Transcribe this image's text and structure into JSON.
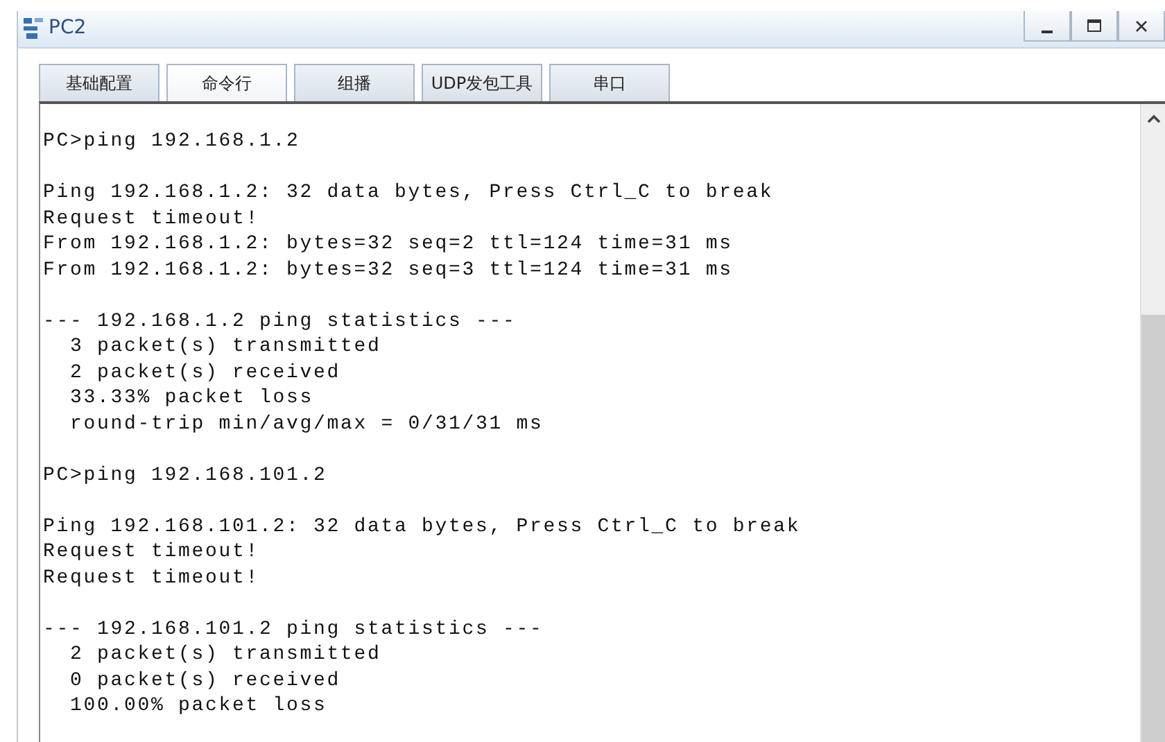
{
  "window": {
    "title": "PC2"
  },
  "tabs": [
    {
      "label": "基础配置",
      "selected": false
    },
    {
      "label": "命令行",
      "selected": true
    },
    {
      "label": "组播",
      "selected": false
    },
    {
      "label": "UDP发包工具",
      "selected": false
    },
    {
      "label": "串口",
      "selected": false
    }
  ],
  "terminal": {
    "blocks": [
      [
        "PC>ping 192.168.1.2"
      ],
      [
        "Ping 192.168.1.2: 32 data bytes, Press Ctrl_C to break",
        "Request timeout!",
        "From 192.168.1.2: bytes=32 seq=2 ttl=124 time=31 ms",
        "From 192.168.1.2: bytes=32 seq=3 ttl=124 time=31 ms"
      ],
      [
        "--- 192.168.1.2 ping statistics ---",
        "  3 packet(s) transmitted",
        "  2 packet(s) received",
        "  33.33% packet loss",
        "  round-trip min/avg/max = 0/31/31 ms"
      ],
      [
        "PC>ping 192.168.101.2"
      ],
      [
        "Ping 192.168.101.2: 32 data bytes, Press Ctrl_C to break",
        "Request timeout!",
        "Request timeout!"
      ],
      [
        "--- 192.168.101.2 ping statistics ---",
        "  2 packet(s) transmitted",
        "  0 packet(s) received",
        "  100.00% packet loss"
      ]
    ]
  }
}
